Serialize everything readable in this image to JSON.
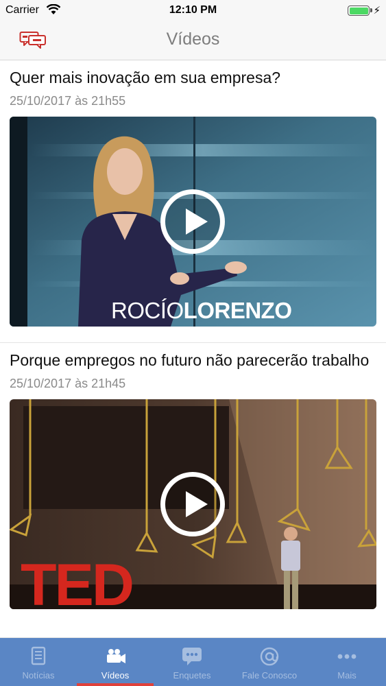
{
  "status_bar": {
    "carrier": "Carrier",
    "time": "12:10 PM"
  },
  "nav": {
    "title": "Vídeos",
    "left_icon": "chat-bubbles-icon"
  },
  "feed": [
    {
      "headline": "Quer mais inovação em sua empresa?",
      "date": "25/10/2017 às 21h55",
      "caption_first": "ROCÍO",
      "caption_last": "LORENZO"
    },
    {
      "headline": "Porque empregos no futuro não parecerão trabalho",
      "date": "25/10/2017 às 21h45",
      "stage_logo": "TED"
    }
  ],
  "tabs": [
    {
      "label": "Notícias",
      "icon": "newspaper-icon",
      "active": false
    },
    {
      "label": "Vídeos",
      "icon": "video-camera-icon",
      "active": true
    },
    {
      "label": "Enquetes",
      "icon": "poll-bubble-icon",
      "active": false
    },
    {
      "label": "Fale Conosco",
      "icon": "at-sign-icon",
      "active": false
    },
    {
      "label": "Mais",
      "icon": "more-dots-icon",
      "active": false
    }
  ],
  "colors": {
    "tab_bar": "#5a86c5",
    "tab_active": "#ffffff",
    "tab_inactive": "#a6bee0",
    "indicator": "#e0413a"
  }
}
